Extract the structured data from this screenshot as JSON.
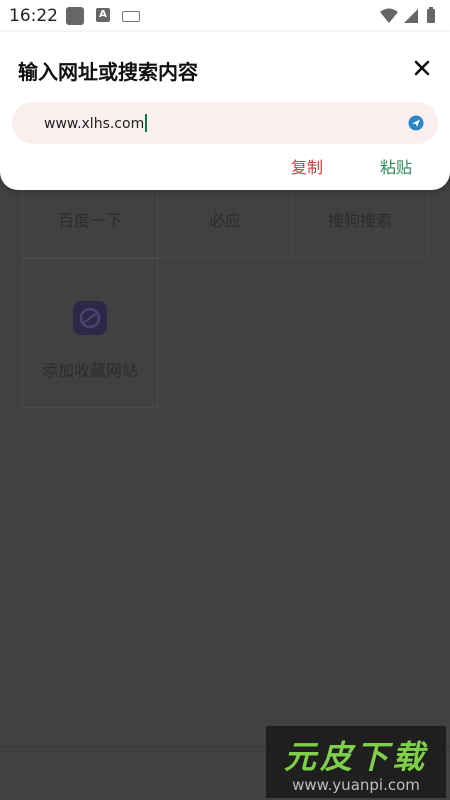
{
  "status_bar": {
    "time": "16:22",
    "icons": [
      "square-icon",
      "a-icon",
      "keyboard-icon",
      "wifi-icon",
      "signal-icon",
      "battery-icon"
    ]
  },
  "dialog": {
    "title": "输入网址或搜索内容",
    "input_value": "www.xlhs.com",
    "copy_label": "复制",
    "paste_label": "粘贴",
    "colors": {
      "copy": "#d23a3a",
      "paste": "#2e8b57",
      "field_bg": "#fbeeee"
    }
  },
  "tiles": {
    "items": [
      "百度一下",
      "必应",
      "搜狗搜索"
    ],
    "add_favorite": "添加收藏网站"
  },
  "watermark": {
    "title": "元皮下载",
    "url": "www.yuanpi.com"
  }
}
